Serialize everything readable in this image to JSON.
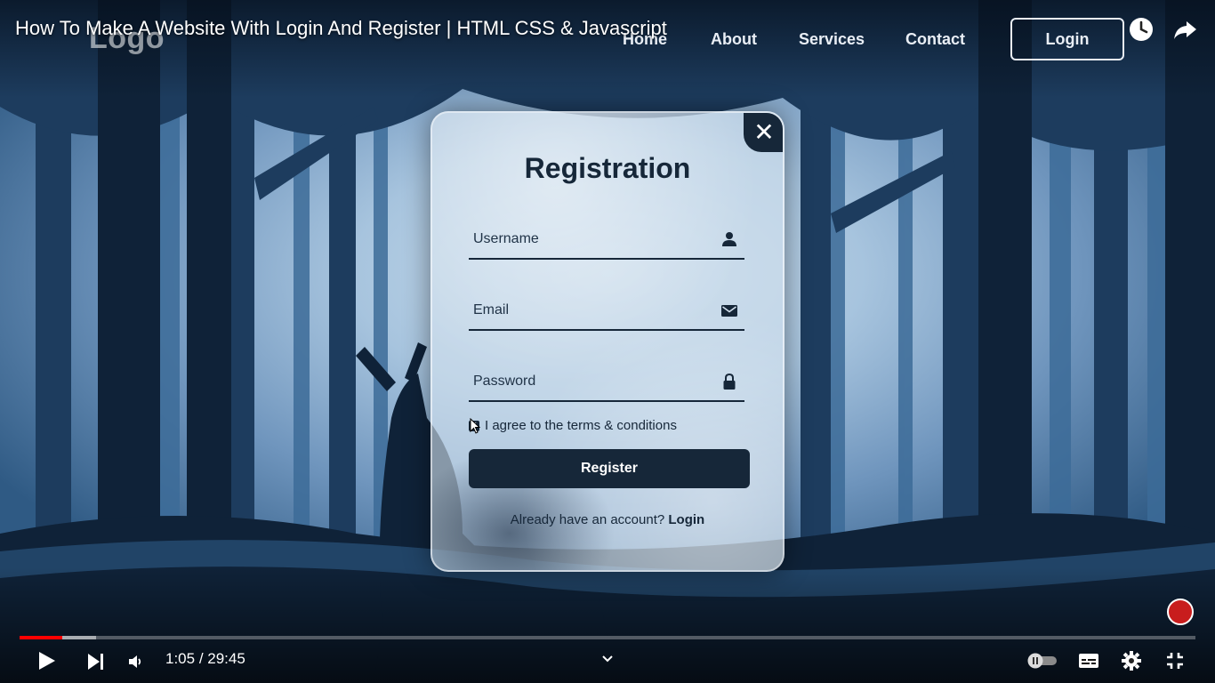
{
  "player": {
    "video_title": "How To Make A Website With Login And Register | HTML CSS & Javascript",
    "current_time": "1:05",
    "duration": "29:45",
    "time_separator": " / ",
    "progress_fraction": 0.036,
    "buffered_fraction": 0.065,
    "accent_color": "#ff0000"
  },
  "site": {
    "logo_text": "Logo",
    "nav": [
      "Home",
      "About",
      "Services",
      "Contact"
    ],
    "login_button": "Login"
  },
  "modal": {
    "title": "Registration",
    "close_glyph": "✕",
    "username_placeholder": "Username",
    "email_placeholder": "Email",
    "password_placeholder": "Password",
    "terms_text": "I agree to the terms & conditions",
    "terms_checked": true,
    "register_button": "Register",
    "account_prompt": "Already have an account?",
    "login_link": "Login",
    "primary_color": "#162739"
  },
  "icons": {
    "watch_later": "clock-icon",
    "share": "share-icon",
    "play": "play-icon",
    "next": "next-icon",
    "volume": "volume-icon",
    "chapters": "chevron-down-icon",
    "autoplay": "autoplay-toggle-icon",
    "captions": "captions-icon",
    "settings": "gear-icon",
    "fullscreen": "exit-fullscreen-icon"
  }
}
